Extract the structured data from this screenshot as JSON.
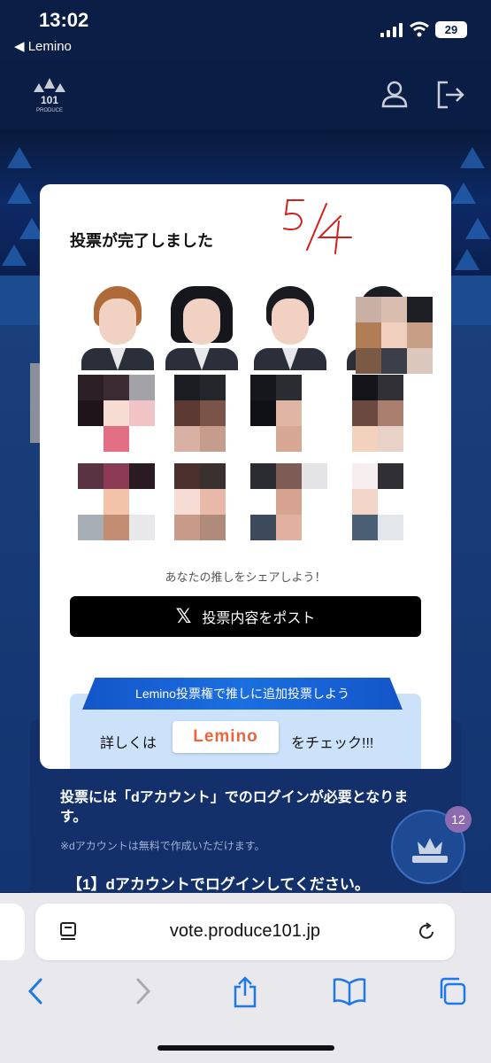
{
  "status_bar": {
    "time": "13:02",
    "back_label": "◀ Lemino",
    "battery": "29"
  },
  "header": {
    "logo_alt": "PRODUCE 101 JAPAN SHINSEKAI",
    "logo_number": "101",
    "logo_sub": "PRODUCE"
  },
  "modal": {
    "title": "投票が完了しました",
    "handwritten_note": "5/4",
    "share_prompt": "あなたの推しをシェアしよう！",
    "post_button": "投票内容をポスト",
    "promo_ribbon": "Lemino投票権で推しに追加投票しよう",
    "promo_left": "詳しくは",
    "promo_brand": "Lemino",
    "promo_right": "をチェック!!!"
  },
  "background_page": {
    "login_text": "投票には「dアカウント」でのログインが必要となります。",
    "free_note": "※dアカウントは無料で作成いただけます。",
    "step_one": "【1】dアカウントでログインしてください。"
  },
  "fab": {
    "badge_count": "12"
  },
  "browser": {
    "url": "vote.produce101.jp"
  },
  "colors": {
    "accent_blue": "#1b6fe0",
    "navy": "#0a1d45",
    "lemino_orange": "#e8663c"
  }
}
